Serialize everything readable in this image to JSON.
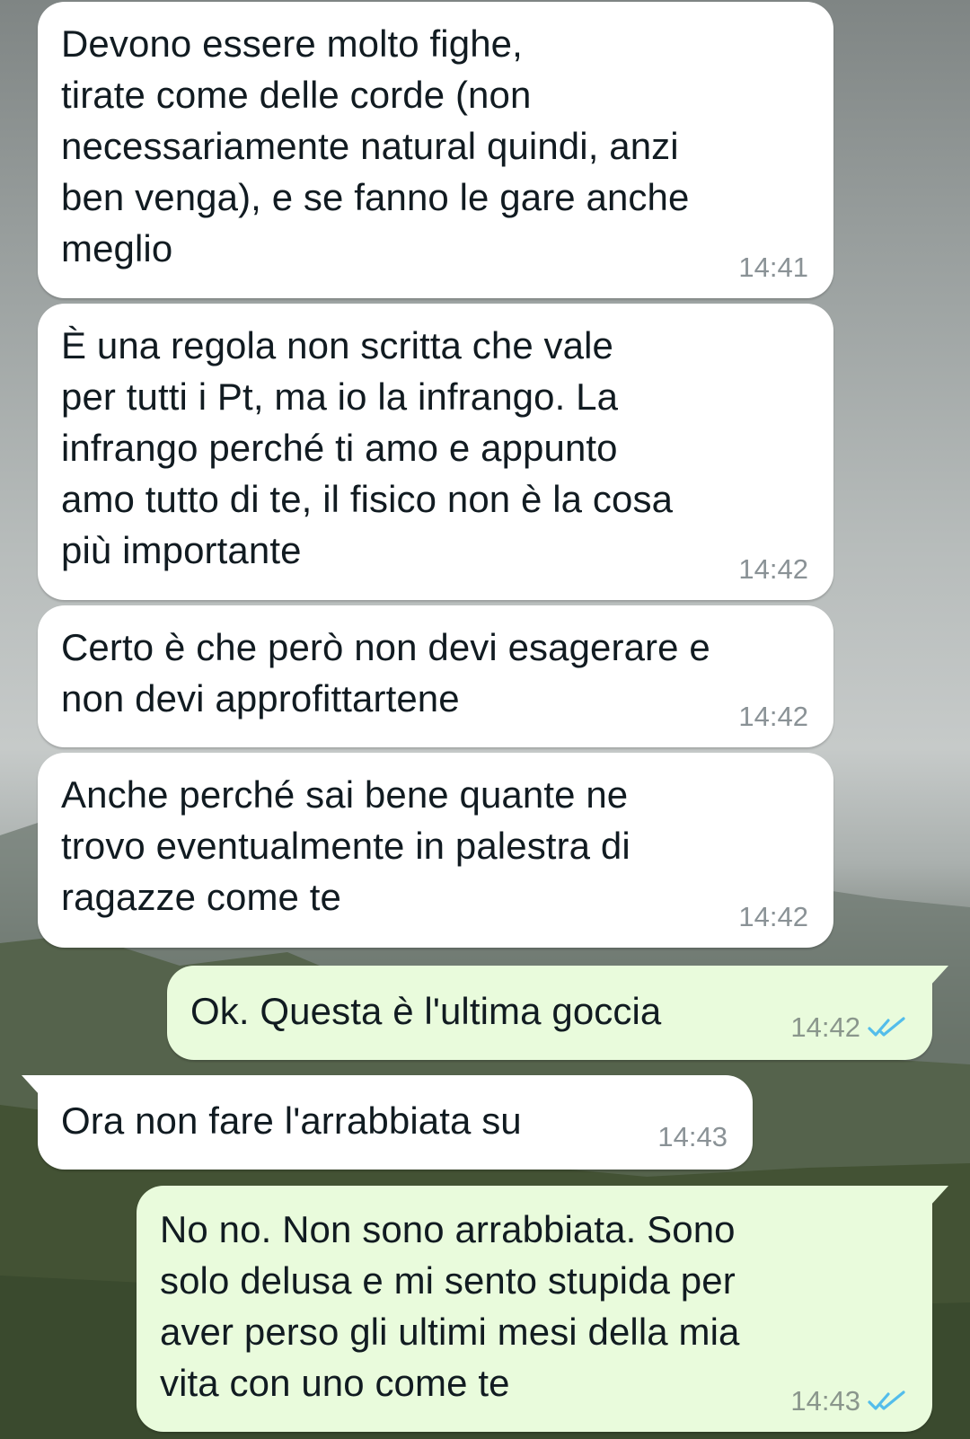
{
  "colors": {
    "incoming_bubble": "#ffffff",
    "outgoing_bubble": "#e9fbdc",
    "text": "#111b21",
    "timestamp": "#8a9296",
    "read_ticks": "#53bdeb"
  },
  "messages": [
    {
      "direction": "incoming",
      "text": "Devono essere molto fighe,\ntirate come delle corde (non\nnecessariamente natural quindi, anzi\nben venga), e se fanno le gare anche\nmeglio",
      "time": "14:41"
    },
    {
      "direction": "incoming",
      "text": "È una regola non scritta che vale\nper tutti i Pt, ma io la infrango. La\ninfrango perché ti amo e appunto\namo tutto di te, il fisico non è la cosa\npiù importante",
      "time": "14:42"
    },
    {
      "direction": "incoming",
      "text": "Certo è che però non devi esagerare e\nnon devi approfittartene",
      "time": "14:42"
    },
    {
      "direction": "incoming",
      "text": "Anche perché sai bene quante ne\ntrovo eventualmente in palestra di\nragazze come te",
      "time": "14:42"
    },
    {
      "direction": "outgoing",
      "text": "Ok. Questa è l'ultima goccia",
      "time": "14:42",
      "status_icon": "double-check-read-icon"
    },
    {
      "direction": "incoming",
      "text": "Ora non fare l'arrabbiata su",
      "time": "14:43"
    },
    {
      "direction": "outgoing",
      "text": "No no. Non sono arrabbiata. Sono\nsolo delusa e mi sento stupida per\naver perso gli ultimi mesi della mia\nvita con uno come te",
      "time": "14:43",
      "status_icon": "double-check-read-icon"
    }
  ]
}
